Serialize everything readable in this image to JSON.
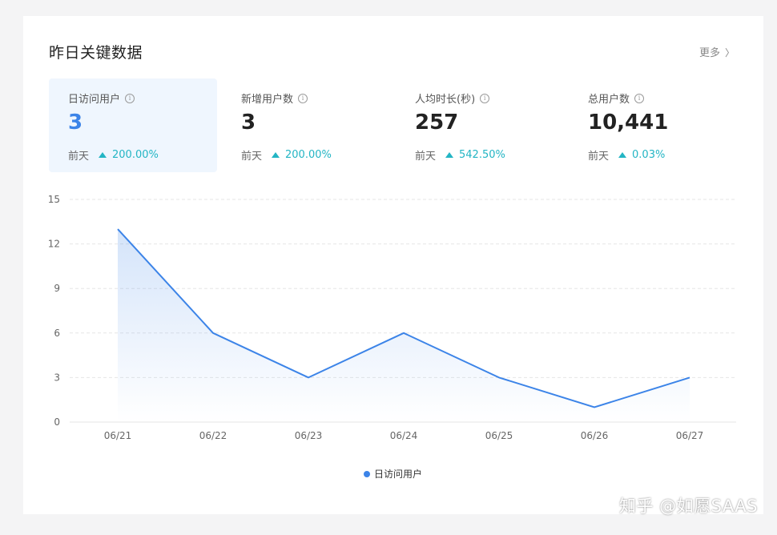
{
  "header": {
    "title": "昨日关键数据",
    "more_label": "更多",
    "more_chevron": "〉"
  },
  "metrics": [
    {
      "label": "日访问用户",
      "value": "3",
      "compare_label": "前天",
      "change": "200.00%",
      "trend": "up"
    },
    {
      "label": "新增用户数",
      "value": "3",
      "compare_label": "前天",
      "change": "200.00%",
      "trend": "up"
    },
    {
      "label": "人均时长(秒)",
      "value": "257",
      "compare_label": "前天",
      "change": "542.50%",
      "trend": "up"
    },
    {
      "label": "总用户数",
      "value": "10,441",
      "compare_label": "前天",
      "change": "0.03%",
      "trend": "up"
    }
  ],
  "icons": {
    "info": "info-icon",
    "trend_up": "triangle-up-icon",
    "more": "chevron-right-icon"
  },
  "colors": {
    "accent": "#3c84e8",
    "trend_up": "#23b5c4",
    "active_card_bg": "#eff6fe"
  },
  "chart_data": {
    "type": "area",
    "categories": [
      "06/21",
      "06/22",
      "06/23",
      "06/24",
      "06/25",
      "06/26",
      "06/27"
    ],
    "series": [
      {
        "name": "日访问用户",
        "values": [
          13,
          6,
          3,
          6,
          3,
          1,
          3
        ],
        "color": "#3c84e8"
      }
    ],
    "yticks": [
      0,
      3,
      6,
      9,
      12,
      15
    ],
    "ylim": [
      0,
      15
    ],
    "grid": true,
    "legend": "bottom"
  },
  "watermark": "知乎 @如愿SAAS"
}
